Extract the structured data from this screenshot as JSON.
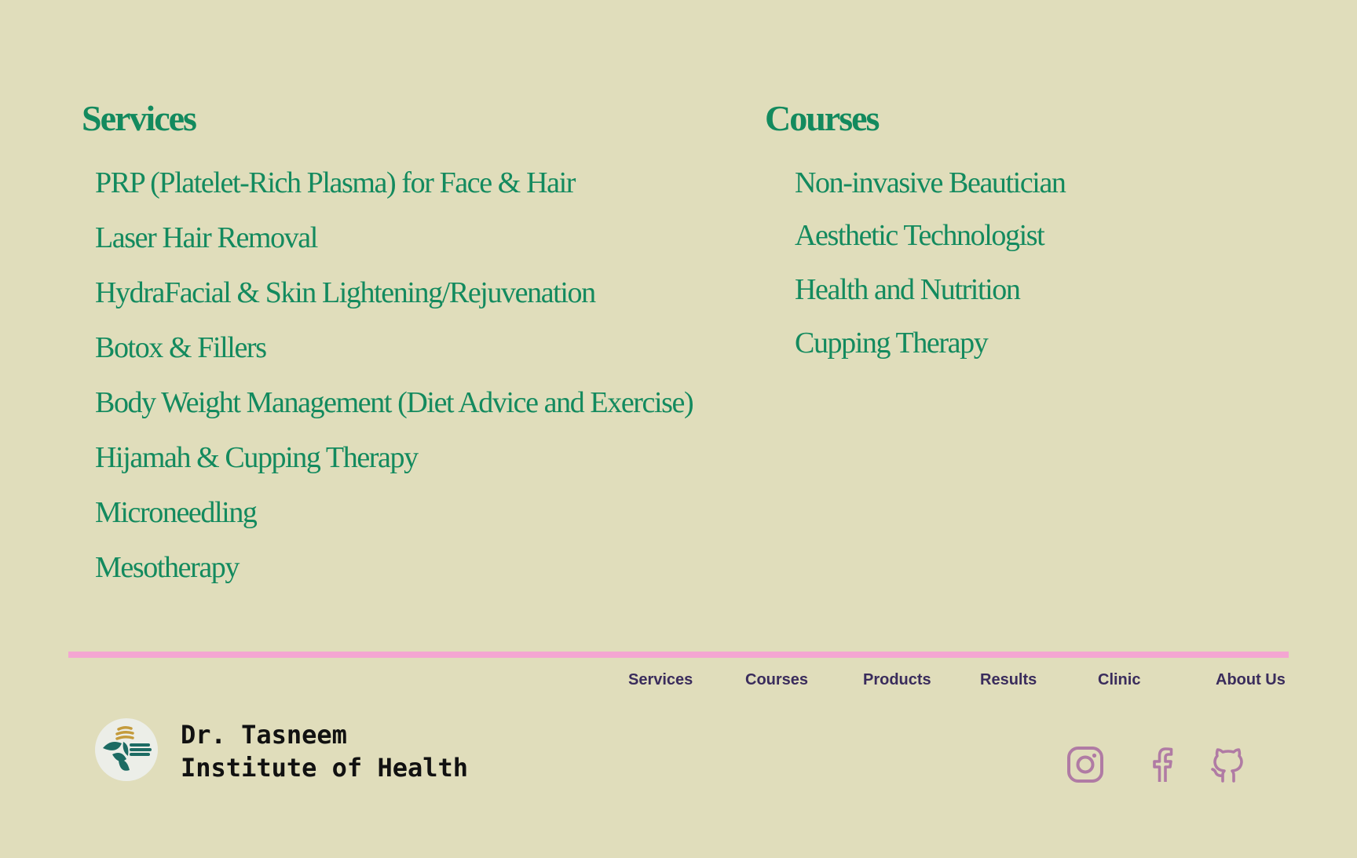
{
  "services": {
    "heading": "Services",
    "items": [
      "PRP (Platelet-Rich Plasma) for Face & Hair",
      "Laser Hair Removal",
      "HydraFacial & Skin Lightening/Rejuvenation",
      "Botox & Fillers",
      "Body Weight Management (Diet Advice and Exercise)",
      "Hijamah & Cupping Therapy",
      "Microneedling",
      "Mesotherapy"
    ]
  },
  "courses": {
    "heading": "Courses",
    "items": [
      "Non-invasive Beautician",
      "Aesthetic Technologist",
      "Health and Nutrition",
      "Cupping Therapy"
    ]
  },
  "footer": {
    "nav": [
      "Services",
      "Courses",
      "Products",
      "Results",
      "Clinic",
      "About Us"
    ],
    "brand_line1": "Dr. Tasneem",
    "brand_line2": "Institute of Health",
    "social": [
      "instagram-icon",
      "facebook-icon",
      "github-icon"
    ]
  },
  "colors": {
    "background": "#e0ddbb",
    "accent_green": "#138a5e",
    "divider_pink": "#f4a6d2",
    "nav_text": "#3a2c5c",
    "social_icon": "#b07ba4"
  }
}
